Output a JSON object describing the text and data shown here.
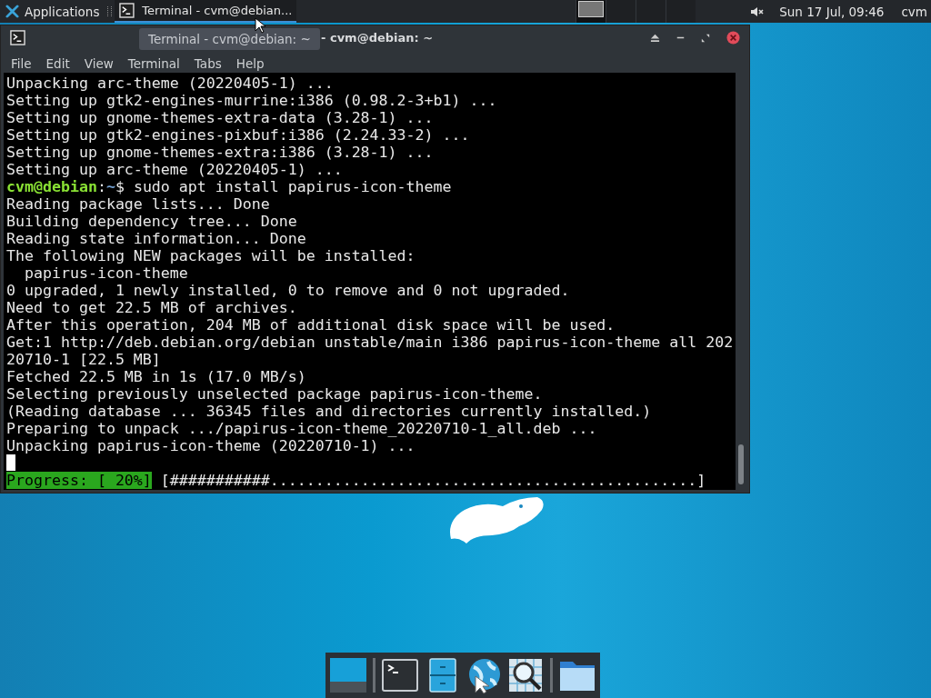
{
  "panel": {
    "applications_label": "Applications",
    "tasks": [
      {
        "label": "Terminal - cvm@debian...",
        "selected": true
      }
    ],
    "workspaces": [
      {
        "selected": true,
        "has_window": true
      },
      {
        "selected": false,
        "has_window": false
      },
      {
        "selected": false,
        "has_window": false
      },
      {
        "selected": false,
        "has_window": false
      }
    ],
    "muted": true,
    "clock": "Sun 17 Jul, 09:46",
    "user": "cvm"
  },
  "tooltip": "Terminal - cvm@debian: ~",
  "window": {
    "title": "- cvm@debian: ~",
    "menu": [
      "File",
      "Edit",
      "View",
      "Terminal",
      "Tabs",
      "Help"
    ],
    "lines": [
      {
        "kind": "output",
        "text": "Unpacking arc-theme (20220405-1) ..."
      },
      {
        "kind": "output",
        "text": "Setting up gtk2-engines-murrine:i386 (0.98.2-3+b1) ..."
      },
      {
        "kind": "output",
        "text": "Setting up gnome-themes-extra-data (3.28-1) ..."
      },
      {
        "kind": "output",
        "text": "Setting up gtk2-engines-pixbuf:i386 (2.24.33-2) ..."
      },
      {
        "kind": "output",
        "text": "Setting up gnome-themes-extra:i386 (3.28-1) ..."
      },
      {
        "kind": "output",
        "text": "Setting up arc-theme (20220405-1) ..."
      },
      {
        "kind": "prompt",
        "host": "cvm@debian",
        "separator": ":",
        "path": "~",
        "command": "$ sudo apt install papirus-icon-theme"
      },
      {
        "kind": "output",
        "text": "Reading package lists... Done"
      },
      {
        "kind": "output",
        "text": "Building dependency tree... Done"
      },
      {
        "kind": "output",
        "text": "Reading state information... Done"
      },
      {
        "kind": "output",
        "text": "The following NEW packages will be installed:"
      },
      {
        "kind": "output",
        "text": "  papirus-icon-theme"
      },
      {
        "kind": "output",
        "text": "0 upgraded, 1 newly installed, 0 to remove and 0 not upgraded."
      },
      {
        "kind": "output",
        "text": "Need to get 22.5 MB of archives."
      },
      {
        "kind": "output",
        "text": "After this operation, 204 MB of additional disk space will be used."
      },
      {
        "kind": "output",
        "text": "Get:1 http://deb.debian.org/debian unstable/main i386 papirus-icon-theme all 202"
      },
      {
        "kind": "output",
        "text": "20710-1 [22.5 MB]"
      },
      {
        "kind": "output",
        "text": "Fetched 22.5 MB in 1s (17.0 MB/s)"
      },
      {
        "kind": "output",
        "text": "Selecting previously unselected package papirus-icon-theme."
      },
      {
        "kind": "output",
        "text": "(Reading database ... 36345 files and directories currently installed.)"
      },
      {
        "kind": "output",
        "text": "Preparing to unpack .../papirus-icon-theme_20220710-1_all.deb ..."
      },
      {
        "kind": "output",
        "text": "Unpacking papirus-icon-theme (20220710-1) ..."
      },
      {
        "kind": "cursor"
      },
      {
        "kind": "progress",
        "label": "Progress: [ 20%]",
        "bar": "[###########...............................................]"
      }
    ]
  },
  "dock": [
    {
      "kind": "desktop"
    },
    {
      "kind": "separator"
    },
    {
      "kind": "terminal"
    },
    {
      "kind": "files"
    },
    {
      "kind": "browser"
    },
    {
      "kind": "search"
    },
    {
      "kind": "separator"
    },
    {
      "kind": "folder"
    }
  ]
}
